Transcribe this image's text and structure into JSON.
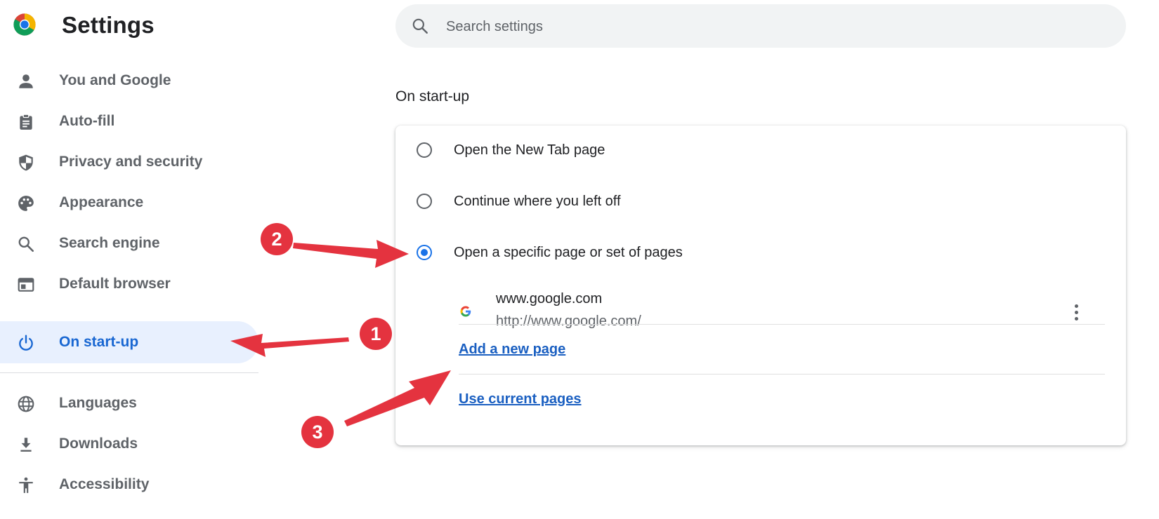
{
  "header": {
    "app_title": "Settings",
    "logo_icon": "chrome-logo-icon"
  },
  "search": {
    "placeholder": "Search settings",
    "value": "",
    "icon": "search-icon"
  },
  "sidebar": {
    "active_item": "On start-up",
    "items": [
      {
        "label": "You and Google",
        "icon": "person-icon"
      },
      {
        "label": "Auto-fill",
        "icon": "clipboard-icon"
      },
      {
        "label": "Privacy and security",
        "icon": "shield-icon"
      },
      {
        "label": "Appearance",
        "icon": "palette-icon"
      },
      {
        "label": "Search engine",
        "icon": "search-icon"
      },
      {
        "label": "Default browser",
        "icon": "browser-window-icon"
      },
      {
        "label": "On start-up",
        "icon": "power-icon"
      },
      {
        "label": "Languages",
        "icon": "globe-icon"
      },
      {
        "label": "Downloads",
        "icon": "download-icon"
      },
      {
        "label": "Accessibility",
        "icon": "accessibility-icon"
      }
    ]
  },
  "main": {
    "section_title": "On start-up",
    "options": [
      {
        "label": "Open the New Tab page",
        "checked": false
      },
      {
        "label": "Continue where you left off",
        "checked": false
      },
      {
        "label": "Open a specific page or set of pages",
        "checked": true
      }
    ],
    "page_entry": {
      "title": "www.google.com",
      "url": "http://www.google.com/",
      "favicon": "google-g-icon",
      "menu_icon": "more-vert-icon"
    },
    "add_page_link": "Add a new page",
    "use_current_link": "Use current pages"
  },
  "annotations": [
    {
      "number": "1",
      "points_to": "On start-up"
    },
    {
      "number": "2",
      "points_to": "Open a specific page or set of pages"
    },
    {
      "number": "3",
      "points_to": "Add a new page"
    }
  ],
  "colors": {
    "accent": "#1a73e8",
    "link": "#1a5fc1",
    "active_nav_bg": "#e8f0fe",
    "annotation_red": "#e4333f"
  }
}
